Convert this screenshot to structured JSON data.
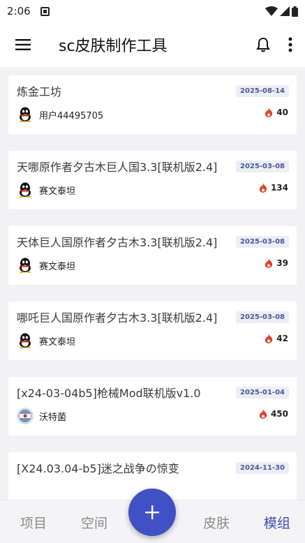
{
  "status_bar": {
    "time": "2:06"
  },
  "app_bar": {
    "title": "sc皮肤制作工具"
  },
  "posts": [
    {
      "title": "炼金工坊",
      "date": "2025-08-14",
      "author": "用户44495705",
      "hot": "40",
      "avatar": "qq-penguin-icon"
    },
    {
      "title": "天哪原作者夕古木巨人国3.3[联机版2.4]",
      "date": "2025-03-08",
      "author": "赛文泰坦",
      "hot": "134",
      "avatar": "qq-penguin-icon"
    },
    {
      "title": "天体巨人国原作者夕古木3.3[联机版2.4]",
      "date": "2025-03-08",
      "author": "赛文泰坦",
      "hot": "39",
      "avatar": "qq-penguin-icon"
    },
    {
      "title": "哪吒巨人国原作者夕古木3.3[联机版2.4]",
      "date": "2025-03-08",
      "author": "赛文泰坦",
      "hot": "42",
      "avatar": "qq-penguin-icon"
    },
    {
      "title": "[x24-03-04b5]枪械Mod联机版v1.0",
      "date": "2025-01-04",
      "author": "沃特菌",
      "hot": "450",
      "avatar": "user-avatar"
    },
    {
      "title": "[X24.03.04-b5]迷之战争の惊变",
      "date": "2024-11-30",
      "author": "",
      "hot": "",
      "avatar": ""
    }
  ],
  "bottom_nav": {
    "tabs": [
      {
        "label": "项目"
      },
      {
        "label": "空间"
      },
      {
        "label": "皮肤"
      },
      {
        "label": "模组"
      }
    ],
    "active": "模组"
  },
  "colors": {
    "accent": "#3f51c4",
    "fire": "#e0402a",
    "date_text": "#4a5a9a"
  }
}
